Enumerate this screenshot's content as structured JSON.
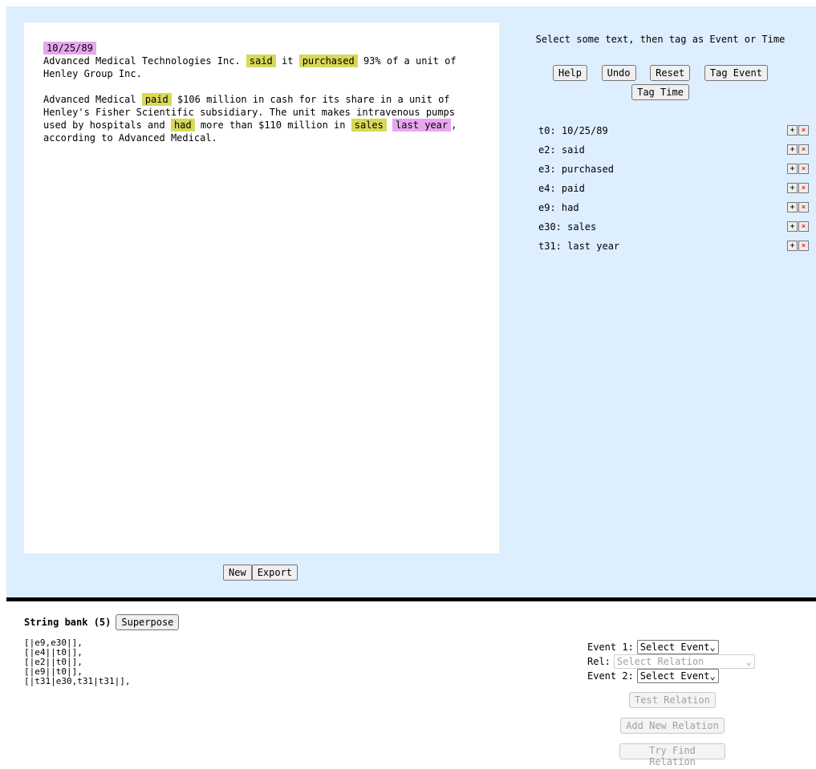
{
  "doc": {
    "date": "10/25/89",
    "p1": {
      "t1": "Advanced Medical Technologies Inc. ",
      "e_said": "said",
      "t2": " it ",
      "e_purchased": "purchased",
      "t3": " 93% of a unit of Henley Group Inc."
    },
    "p2": {
      "t1": "Advanced Medical ",
      "e_paid": "paid",
      "t2": " $106 million in cash for its share in a unit of Henley's Fisher Scientific subsidiary. The unit makes intravenous pumps used by hospitals and ",
      "e_had": "had",
      "t3": " more than $110 million in ",
      "e_sales": "sales",
      "t4": " ",
      "t_lastyear": "last year",
      "t5": ", according to Advanced Medical."
    },
    "new_label": "New",
    "export_label": "Export"
  },
  "panel": {
    "instruction": "Select some text, then tag as Event or Time",
    "help": "Help",
    "undo": "Undo",
    "reset": "Reset",
    "tag_event": "Tag Event",
    "tag_time": "Tag Time",
    "tags": [
      {
        "label": "t0: 10/25/89"
      },
      {
        "label": "e2: said"
      },
      {
        "label": "e3: purchased"
      },
      {
        "label": "e4: paid"
      },
      {
        "label": "e9: had"
      },
      {
        "label": "e30: sales"
      },
      {
        "label": "t31: last year"
      }
    ],
    "add_glyph": "+",
    "remove_glyph": "×"
  },
  "bank": {
    "title": "String bank (5)",
    "superpose": "Superpose",
    "items": [
      "[|e9,e30|],",
      "[|e4||t0|],",
      "[|e2||t0|],",
      "[|e9||t0|],",
      "[|t31|e30,t31|t31|],"
    ]
  },
  "relation": {
    "event1_label": "Event 1:",
    "event1_value": "Select Event",
    "rel_label": "Rel:",
    "rel_value": "Select Relation",
    "event2_label": "Event 2:",
    "event2_value": "Select Event",
    "test": "Test Relation",
    "add": "Add New Relation",
    "find": "Try Find Relation"
  },
  "colors": {
    "event_highlight": "#d8d858",
    "time_highlight": "#e7a7ee",
    "panel_bg": "#ddeeff"
  }
}
